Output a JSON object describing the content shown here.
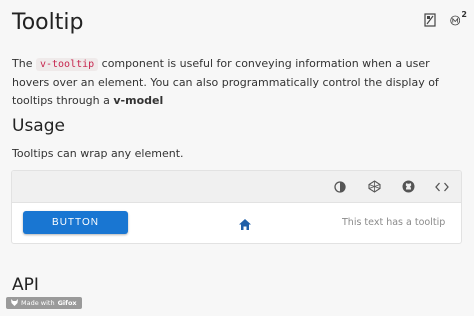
{
  "page": {
    "title": "Tooltip",
    "header_icons": [
      "ebook-icon",
      "medium-icon"
    ],
    "header_superscript": "2"
  },
  "intro": {
    "prefix": "The ",
    "code": "v-tooltip",
    "middle": " component is useful for conveying information when a user hovers over an element. You can also programmatically control the display of tooltips through a ",
    "bold": "v-model"
  },
  "usage": {
    "heading": "Usage",
    "description": "Tooltips can wrap any element."
  },
  "example": {
    "toolbar_icons": [
      "invert-colors-icon",
      "codepen-icon",
      "github-icon",
      "code-icon"
    ],
    "button_label": "BUTTON",
    "home_icon": "home-icon",
    "tooltip_text": "This text has a tooltip"
  },
  "api": {
    "heading": "API"
  },
  "watermark": {
    "prefix": "Made with ",
    "brand": "Gifox"
  },
  "colors": {
    "primary": "#1976d2",
    "code": "#c7254e",
    "background": "#f7f7f7"
  }
}
